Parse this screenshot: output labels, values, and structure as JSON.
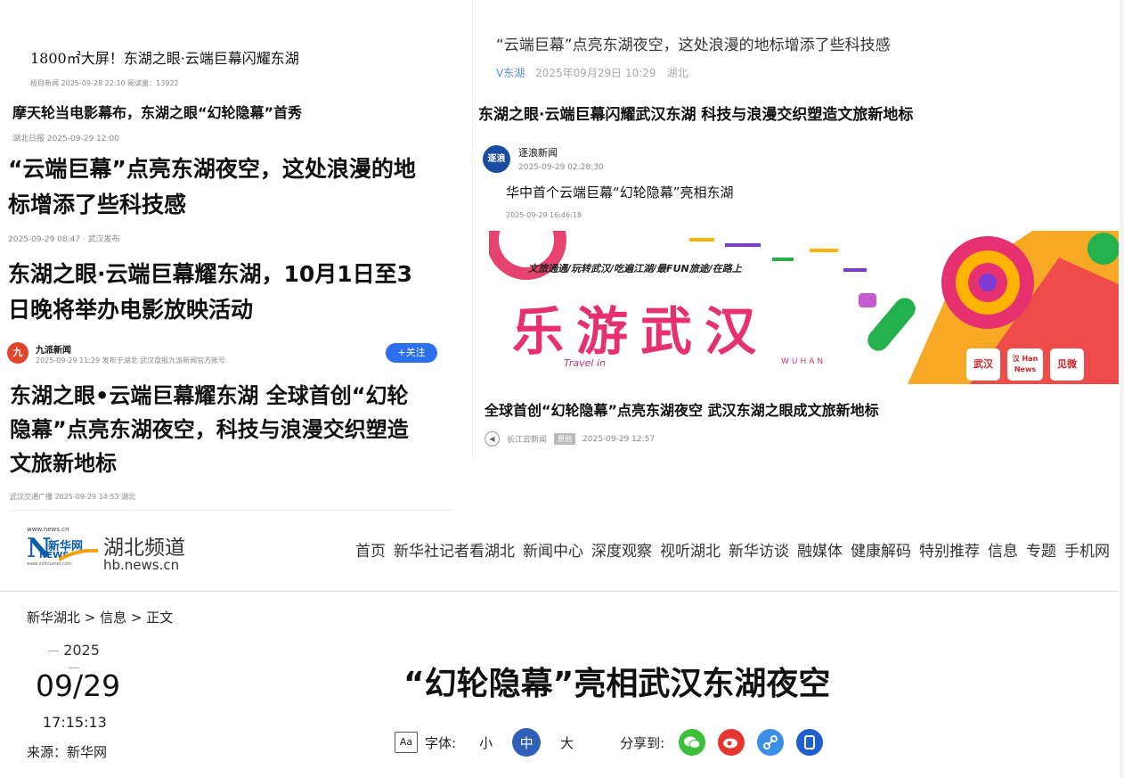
{
  "left": {
    "item1": {
      "title": "1800㎡大屏！东湖之眼·云端巨幕闪耀东湖",
      "meta": "极目新闻   2025-09-28 22:10   阅读量：13922"
    },
    "item2": {
      "title": "摩天轮当电影幕布，东湖之眼“幻轮隐幕”首秀",
      "meta": "湖北日报   2025-09-29 12:00"
    },
    "item3": {
      "title_line1": "“云端巨幕”点亮东湖夜空，这处浪漫的地",
      "title_line2": "标增添了些科技感",
      "meta": "2025-09-29 08:47 · 武汉发布"
    },
    "item4": {
      "title_line1": "东湖之眼·云端巨幕耀东湖，10月1日至3",
      "title_line2": "日晚将举办电影放映活动"
    },
    "item5": {
      "source": "九派新闻",
      "meta": "2025-09-29 11:29 发布于湖北 武汉盘报九派新闻官方账号",
      "follow": "+关注",
      "avatar_char": "九"
    },
    "item6": {
      "title_line1": "东湖之眼•云端巨幕耀东湖 全球首创“幻轮",
      "title_line2": "隐幕”点亮东湖夜空，科技与浪漫交织塑造",
      "title_line3": "文旅新地标",
      "meta": "武汉交通广播   2025-09-29 14:53   湖北"
    }
  },
  "right": {
    "item1": {
      "title": "“云端巨幕”点亮东湖夜空，这处浪漫的地标增添了些科技感",
      "source": "V东湖",
      "time": "2025年09月29日 10:29",
      "region": "湖北"
    },
    "item2": {
      "title": "东湖之眼·云端巨幕闪耀武汉东湖 科技与浪漫交织塑造文旅新地标"
    },
    "item3": {
      "source": "逐浪新闻",
      "time": "2025-09-29 02:28:30",
      "title": "华中首个云端巨幕“幻轮隐幕”亮相东湖",
      "meta": "2025-09-29 16:46:18",
      "avatar_char": "逐浪"
    },
    "poster": {
      "slogan": "文旅通通/玩转武汉/吃遍江湖/最FUN旅途/在路上",
      "big_text": "乐游武汉",
      "travel_in": "Travel in",
      "wuhan": "WUHAN",
      "badge1": "武汉",
      "badge2": "汉 Han News",
      "badge3": "见微"
    },
    "item4": {
      "title": "全球首创“幻轮隐幕”点亮东湖夜空 武汉东湖之眼成文旅新地标",
      "source": "长江云新闻",
      "tag": "原创",
      "time": "2025-09-29 12:57"
    }
  },
  "site": {
    "logo_url_text": "www.news.cn",
    "logo_brand": "新华网",
    "logo_news": "NEWS",
    "logo_sub": "www.xinhuanet.com",
    "channel": "湖北频道",
    "channel_url": "hb.news.cn",
    "nav": [
      "首页",
      "新华社记者看湖北",
      "新闻中心",
      "深度观察",
      "视听湖北",
      "新华访谈",
      "融媒体",
      "健康解码",
      "特别推荐",
      "信息",
      "专题",
      "手机网"
    ]
  },
  "article": {
    "breadcrumb": "新华湖北 > 信息 > 正文",
    "year": "2025",
    "date": "09/29",
    "time": "17:15:13",
    "source": "来源：新华网",
    "headline": "“幻轮隐幕”亮相武汉东湖夜空",
    "font_icon": "Aa",
    "font_label": "字体:",
    "font_small": "小",
    "font_medium": "中",
    "font_large": "大",
    "share_label": "分享到:"
  },
  "colors": {
    "accent_blue": "#2c70ee",
    "brand_blue": "#0b5cab",
    "wechat": "#3cbf3a",
    "weibo": "#e6352e",
    "link": "#3b8fe6",
    "mobile": "#1f5fcf"
  }
}
